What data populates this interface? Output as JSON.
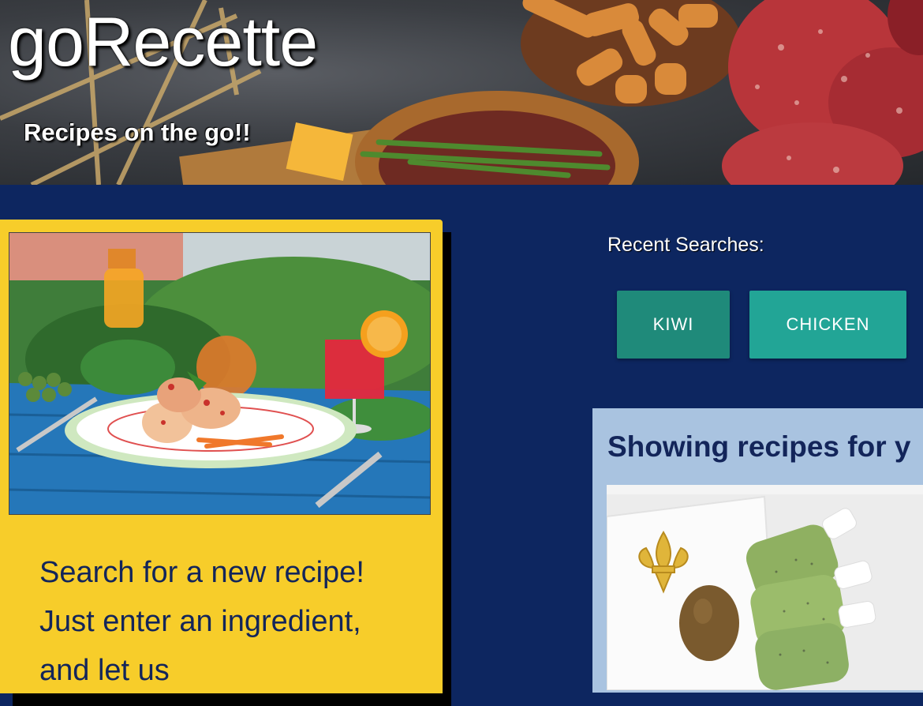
{
  "header": {
    "brand": "goRecette",
    "tagline": "Recipes on the go!!"
  },
  "search_card": {
    "image_alt": "plated fish rolls with drinks on a blue table",
    "intro_text": "Search for a new recipe! Just enter an ingredient, and let us"
  },
  "recent_searches": {
    "label": "Recent Searches:",
    "items": [
      "KIWI",
      "CHICKEN"
    ]
  },
  "results": {
    "title": "Showing recipes for y",
    "first_recipe_image_alt": "kiwi popsicles next to a kiwi and a fleur-de-lis napkin"
  },
  "colors": {
    "page_background": "#0d2660",
    "card_yellow": "#f7cd2a",
    "navy_text": "#13255a",
    "chip_kiwi": "#1f8a7a",
    "chip_chicken": "#22a596",
    "results_panel": "#a9c3e0"
  }
}
